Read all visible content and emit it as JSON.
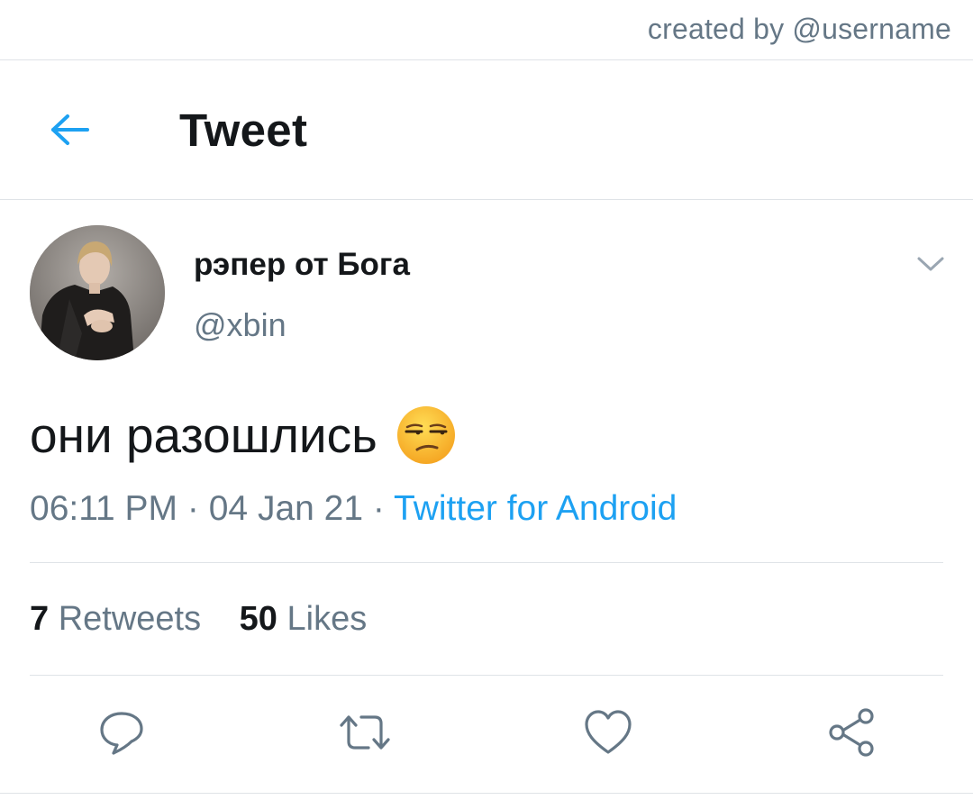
{
  "credit": "created by @username",
  "header": {
    "title": "Tweet",
    "back_icon": "arrow-left-icon"
  },
  "tweet": {
    "display_name": "рэпер от Бога",
    "handle": "@xbin",
    "text": "они разошлись",
    "emoji": "unamused-face",
    "time": "06:11 PM",
    "date": "04 Jan 21",
    "separator": "·",
    "source": "Twitter for Android",
    "retweets_count": "7",
    "retweets_label": "Retweets",
    "likes_count": "50",
    "likes_label": "Likes"
  },
  "actions": [
    {
      "icon": "reply-icon"
    },
    {
      "icon": "retweet-icon"
    },
    {
      "icon": "like-icon"
    },
    {
      "icon": "share-icon"
    }
  ],
  "colors": {
    "accent": "#1da1f2",
    "text_primary": "#14171a",
    "text_secondary": "#657786",
    "divider": "#dfe3e7"
  }
}
